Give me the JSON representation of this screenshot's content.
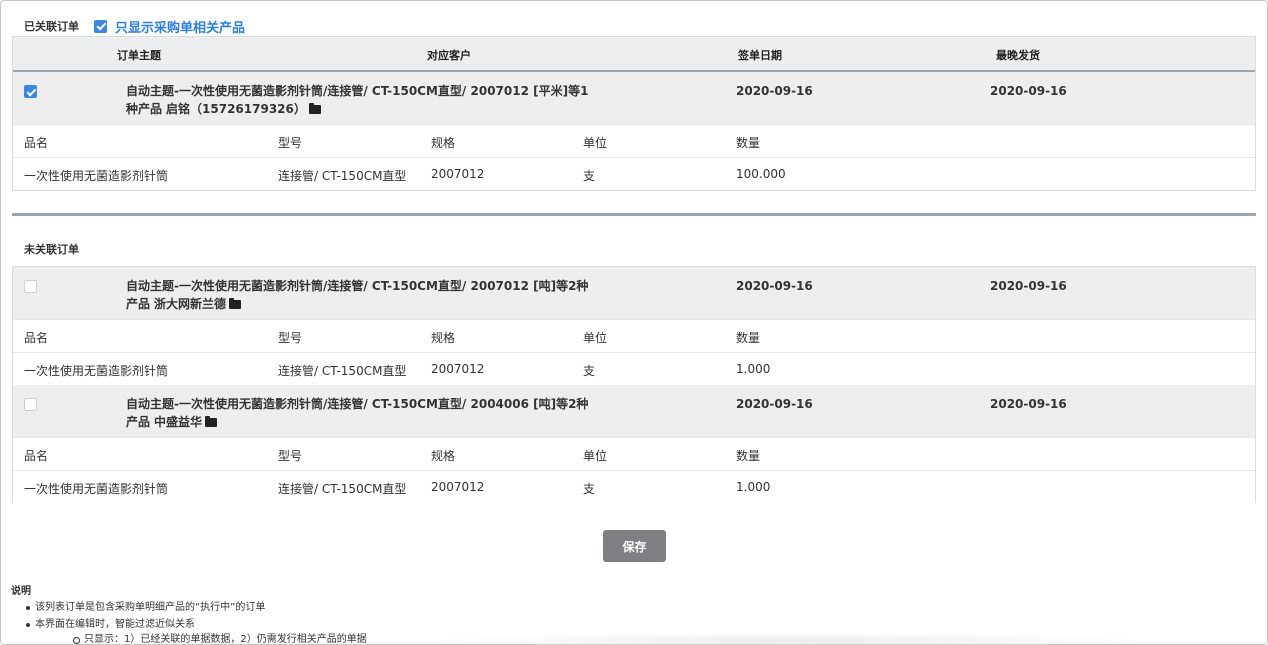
{
  "linked_section": {
    "label": "已关联订单",
    "filter_checked": true,
    "filter_label": "只显示采购单相关产品"
  },
  "columns": {
    "subject": "订单主题",
    "customer": "对应客户",
    "sign_date": "签单日期",
    "latest_ship": "最晚发货"
  },
  "detail_headers": {
    "name": "品名",
    "model": "型号",
    "spec": "规格",
    "unit": "单位",
    "qty": "数量"
  },
  "linked_orders": [
    {
      "checked": true,
      "subject": "自动主题-一次性使用无菌造影剂针筒/连接管/ CT-150CM直型/ 2007012 [平米]等1种产品",
      "customer": "启铭（15726179326）",
      "sign_date": "2020-09-16",
      "latest_ship": "2020-09-16",
      "item": {
        "name": "一次性使用无菌造影剂针筒",
        "model": "连接管/ CT-150CM直型",
        "spec": "2007012",
        "unit": "支",
        "qty": "100.000"
      }
    }
  ],
  "unlinked_section": {
    "label": "未关联订单"
  },
  "unlinked_orders": [
    {
      "checked": false,
      "subject": "自动主题-一次性使用无菌造影剂针筒/连接管/ CT-150CM直型/ 2007012 [吨]等2种产品",
      "customer": "浙大网新兰德",
      "sign_date": "2020-09-16",
      "latest_ship": "2020-09-16",
      "item": {
        "name": "一次性使用无菌造影剂针筒",
        "model": "连接管/ CT-150CM直型",
        "spec": "2007012",
        "unit": "支",
        "qty": "1.000"
      }
    },
    {
      "checked": false,
      "subject": "自动主题-一次性使用无菌造影剂针筒/连接管/ CT-150CM直型/ 2004006 [吨]等2种产品",
      "customer": "中盛益华",
      "sign_date": "2020-09-16",
      "latest_ship": "2020-09-16",
      "item": {
        "name": "一次性使用无菌造影剂针筒",
        "model": "连接管/ CT-150CM直型",
        "spec": "2007012",
        "unit": "支",
        "qty": "1.000"
      }
    }
  ],
  "save_label": "保存",
  "notes": {
    "title": "说明",
    "items": [
      "该列表订单是包含采购单明细产品的“执行中”的订单",
      "本界面在编辑时，智能过滤近似关系"
    ],
    "sub_items": [
      "只显示：1）已经关联的单据数据，2）仍需发行相关产品的单据"
    ]
  },
  "icons": {
    "checkbox": "checkbox-icon",
    "folder": "folder-open-icon"
  },
  "colors": {
    "accent": "#3b87e0",
    "header_bg": "#eceef0",
    "row_bg": "#eeeeee",
    "divider": "#9aa6b2",
    "save_button": "#7d7f82"
  }
}
